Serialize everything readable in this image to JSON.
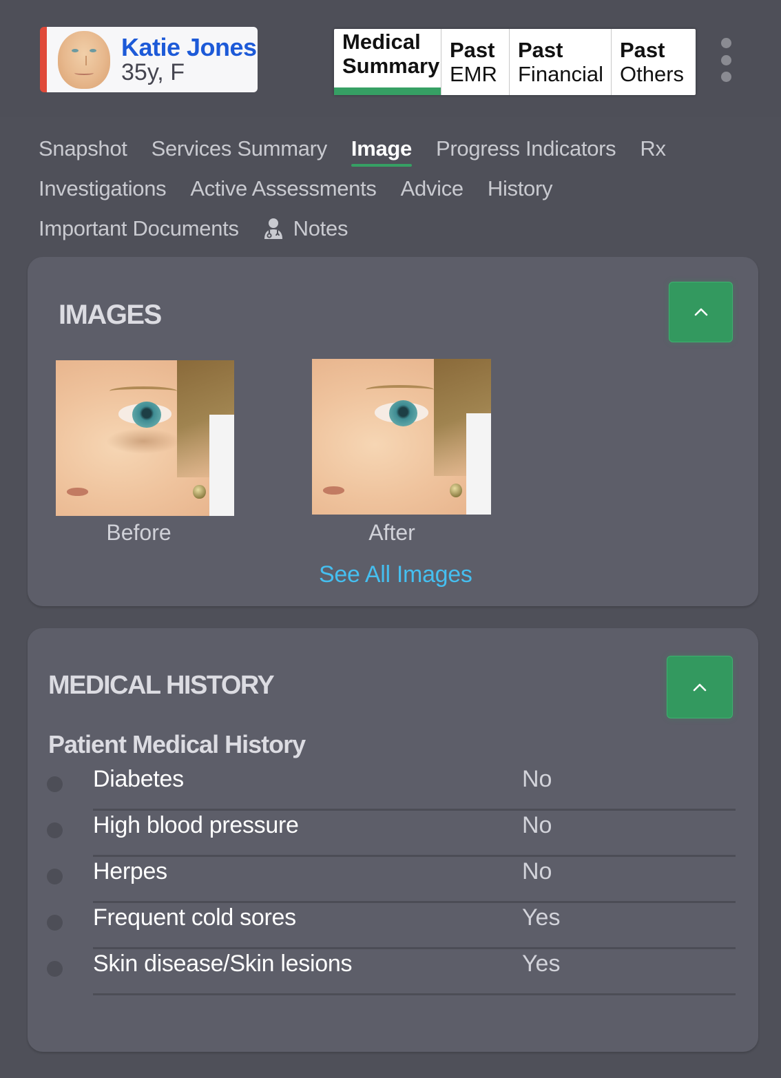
{
  "patient": {
    "name": "Katie Jones",
    "meta": "35y, F",
    "status_color": "#e04a3a"
  },
  "top_tabs": [
    {
      "line1": "Medical",
      "line2": "Summary",
      "active": true
    },
    {
      "line1": "Past",
      "line2": "EMR",
      "active": false
    },
    {
      "line1": "Past",
      "line2": "Financial",
      "active": false
    },
    {
      "line1": "Past",
      "line2": "Others",
      "active": false
    }
  ],
  "subnav": {
    "rows": [
      [
        "Snapshot",
        "Services Summary",
        "Image",
        "Progress Indicators",
        "Rx"
      ],
      [
        "Investigations",
        "Active Assessments",
        "Advice",
        "History"
      ],
      [
        "Important Documents",
        "Notes"
      ]
    ],
    "active": "Image",
    "icons": {
      "Notes": "doctor-icon"
    }
  },
  "images_panel": {
    "title": "IMAGES",
    "collapse_icon": "chevron-up-icon",
    "photos": [
      {
        "caption": "Before"
      },
      {
        "caption": "After"
      }
    ],
    "see_all": "See All Images"
  },
  "history_panel": {
    "title": "MEDICAL HISTORY",
    "collapse_icon": "chevron-up-icon",
    "subtitle": "Patient Medical History",
    "items": [
      {
        "condition": "Diabetes",
        "answer": "No"
      },
      {
        "condition": "High blood pressure",
        "answer": "No"
      },
      {
        "condition": "Herpes",
        "answer": "No"
      },
      {
        "condition": "Frequent cold sores",
        "answer": "Yes"
      },
      {
        "condition": "Skin disease/Skin lesions",
        "answer": "Yes"
      }
    ]
  },
  "colors": {
    "accent_green": "#36a064",
    "link_blue": "#45bff0",
    "name_blue": "#1d5ad8",
    "panel_bg": "#5d5e69",
    "page_bg": "#4f5059"
  }
}
